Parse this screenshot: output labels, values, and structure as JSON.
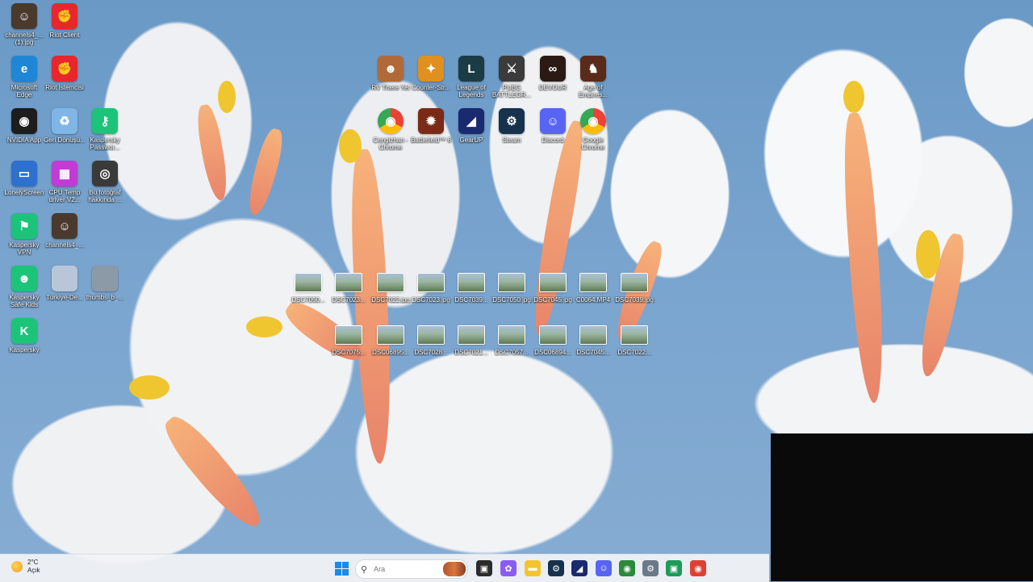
{
  "desktop_icons": [
    {
      "name": "desktop-icon-channels4-jpg",
      "label": "channels4_...(1).jpg",
      "color": "#4a3a2e",
      "glyph": "☺"
    },
    {
      "name": "desktop-icon-riot-client",
      "label": "Riot Client",
      "color": "#e8262d",
      "glyph": "✊"
    },
    {
      "name": "desktop-icon-microsoft-edge",
      "label": "Microsoft Edge",
      "color": "#1f86d6",
      "glyph": "e"
    },
    {
      "name": "desktop-icon-riot-istemcisi",
      "label": "Riot İstemcisi",
      "color": "#e8262d",
      "glyph": "✊"
    },
    {
      "name": "desktop-icon-nvidia-app",
      "label": "NVIDIA App",
      "color": "#1d1d1d",
      "glyph": "◉"
    },
    {
      "name": "desktop-icon-geri-donusum",
      "label": "Geri Dönüşü...",
      "color": "#7fb6e6",
      "glyph": "♻"
    },
    {
      "name": "desktop-icon-kaspersky-password",
      "label": "Kaspersky Passwor...",
      "color": "#1cc47a",
      "glyph": "⚷"
    },
    {
      "name": "desktop-icon-lonelyscreen",
      "label": "LonelyScreen",
      "color": "#2f6fd0",
      "glyph": "▭"
    },
    {
      "name": "desktop-icon-cpu-temp",
      "label": "CPU Temp driver V2...",
      "color": "#c23bd4",
      "glyph": "▦"
    },
    {
      "name": "desktop-icon-bu-fotograf",
      "label": "Bu fotoğraf hakkında ...",
      "color": "#3a3a3a",
      "glyph": "◎"
    },
    {
      "name": "desktop-icon-kaspersky-vpn",
      "label": "Kaspersky VPN",
      "color": "#1cc47a",
      "glyph": "⚑"
    },
    {
      "name": "desktop-icon-channels4-2",
      "label": "channels4_...",
      "color": "#4a3a2e",
      "glyph": "☺"
    },
    {
      "name": "desktop-icon-kaspersky-safe-kids",
      "label": "Kaspersky Safe Kids",
      "color": "#1cc47a",
      "glyph": "☻"
    },
    {
      "name": "desktop-icon-turkiye-de",
      "label": "Turkiye-De...",
      "color": "#b8c6d8",
      "glyph": ""
    },
    {
      "name": "desktop-icon-thumbs-b",
      "label": "thumbs_b_...",
      "color": "#8c9aa8",
      "glyph": ""
    },
    {
      "name": "desktop-icon-kaspersky",
      "label": "Kaspersky",
      "color": "#1cc47a",
      "glyph": "K"
    },
    {
      "name": "desktop-icon-rv-there-yet",
      "label": "RV There Yet",
      "color": "#b06a3a",
      "glyph": "☻"
    },
    {
      "name": "desktop-icon-counter-strike",
      "label": "Counter-Str...",
      "color": "#e0901e",
      "glyph": "✦"
    },
    {
      "name": "desktop-icon-league-of-legends",
      "label": "League of Legends",
      "color": "#1b3b45",
      "glyph": "L"
    },
    {
      "name": "desktop-icon-pubg",
      "label": "PUBG BATTLEGR...",
      "color": "#3b3b3b",
      "glyph": "⚔"
    },
    {
      "name": "desktop-icon-devour",
      "label": "DEVOUR",
      "color": "#2b1a14",
      "glyph": "∞"
    },
    {
      "name": "desktop-icon-age-of-empires",
      "label": "Age of Empires...",
      "color": "#5a2a1a",
      "glyph": "♞"
    },
    {
      "name": "desktop-icon-cengizhan-chrome",
      "label": "Cengizhan - Chrome",
      "color": "#ffffff",
      "glyph": "◉"
    },
    {
      "name": "desktop-icon-battlefield-6",
      "label": "Battlefield™ 6",
      "color": "#7a2a16",
      "glyph": "✹"
    },
    {
      "name": "desktop-icon-gearup",
      "label": "GearUP",
      "color": "#1a2a6e",
      "glyph": "◢"
    },
    {
      "name": "desktop-icon-steam",
      "label": "Steam",
      "color": "#17324d",
      "glyph": "⚙"
    },
    {
      "name": "desktop-icon-discord",
      "label": "Discord",
      "color": "#5865f2",
      "glyph": "☺"
    },
    {
      "name": "desktop-icon-google-chrome",
      "label": "Google Chrome",
      "color": "#ffffff",
      "glyph": "◉"
    },
    {
      "name": "desktop-icon-dsc7050",
      "label": "DSC7050...",
      "color": "",
      "glyph": ""
    },
    {
      "name": "desktop-icon-dsc7023a",
      "label": "DSC7023...",
      "color": "",
      "glyph": ""
    },
    {
      "name": "desktop-icon-dsc7022",
      "label": "DSC7022.jpg",
      "color": "",
      "glyph": ""
    },
    {
      "name": "desktop-icon-dsc7023b",
      "label": "DSC7023.jpg",
      "color": "",
      "glyph": ""
    },
    {
      "name": "desktop-icon-dsc7039",
      "label": "DSC7039...",
      "color": "",
      "glyph": ""
    },
    {
      "name": "desktop-icon-dsc7050-jpg",
      "label": "DSC7050.jpg",
      "color": "",
      "glyph": ""
    },
    {
      "name": "desktop-icon-dsc7045",
      "label": "DSC7045.jpg",
      "color": "",
      "glyph": ""
    },
    {
      "name": "desktop-icon-c0064",
      "label": "C0064.MP4",
      "color": "",
      "glyph": ""
    },
    {
      "name": "desktop-icon-dsc7039-jpg",
      "label": "DSC7039.jpg",
      "color": "",
      "glyph": ""
    },
    {
      "name": "desktop-icon-dsc7075",
      "label": "DSC7075...",
      "color": "",
      "glyph": ""
    },
    {
      "name": "desktop-icon-dsc06895",
      "label": "DSC06895...",
      "color": "",
      "glyph": ""
    },
    {
      "name": "desktop-icon-dsc7028",
      "label": "DSC7028...",
      "color": "",
      "glyph": ""
    },
    {
      "name": "desktop-icon-dsc7021",
      "label": "DSC7021...",
      "color": "",
      "glyph": ""
    },
    {
      "name": "desktop-icon-dsc7057",
      "label": "DSC7057...",
      "color": "",
      "glyph": ""
    },
    {
      "name": "desktop-icon-dsc06894",
      "label": "DSC06894...",
      "color": "",
      "glyph": ""
    },
    {
      "name": "desktop-icon-dsc7045b",
      "label": "DSC7045...",
      "color": "",
      "glyph": ""
    },
    {
      "name": "desktop-icon-dsc7022b",
      "label": "DSC7022...",
      "color": "",
      "glyph": ""
    }
  ],
  "taskbar": {
    "weather": {
      "temp": "2°C",
      "condition": "Açık"
    },
    "search": {
      "placeholder": "Ara"
    },
    "apps": [
      {
        "name": "taskbar-task-view",
        "color": "#2b2b2b",
        "glyph": "▣"
      },
      {
        "name": "taskbar-copilot",
        "color": "#8a5cf5",
        "glyph": "✿"
      },
      {
        "name": "taskbar-file-explorer",
        "color": "#f4c430",
        "glyph": "▬"
      },
      {
        "name": "taskbar-steam",
        "color": "#17324d",
        "glyph": "⚙"
      },
      {
        "name": "taskbar-visual-studio",
        "color": "#1a2a6e",
        "glyph": "◢"
      },
      {
        "name": "taskbar-discord",
        "color": "#5865f2",
        "glyph": "☺"
      },
      {
        "name": "taskbar-chrome-notify",
        "color": "#2a8a3a",
        "glyph": "◉"
      },
      {
        "name": "taskbar-settings",
        "color": "#6b7a8a",
        "glyph": "⚙"
      },
      {
        "name": "taskbar-android",
        "color": "#1d9b5a",
        "glyph": "▣"
      },
      {
        "name": "taskbar-google-chrome",
        "color": "#e04034",
        "glyph": "◉"
      }
    ]
  }
}
